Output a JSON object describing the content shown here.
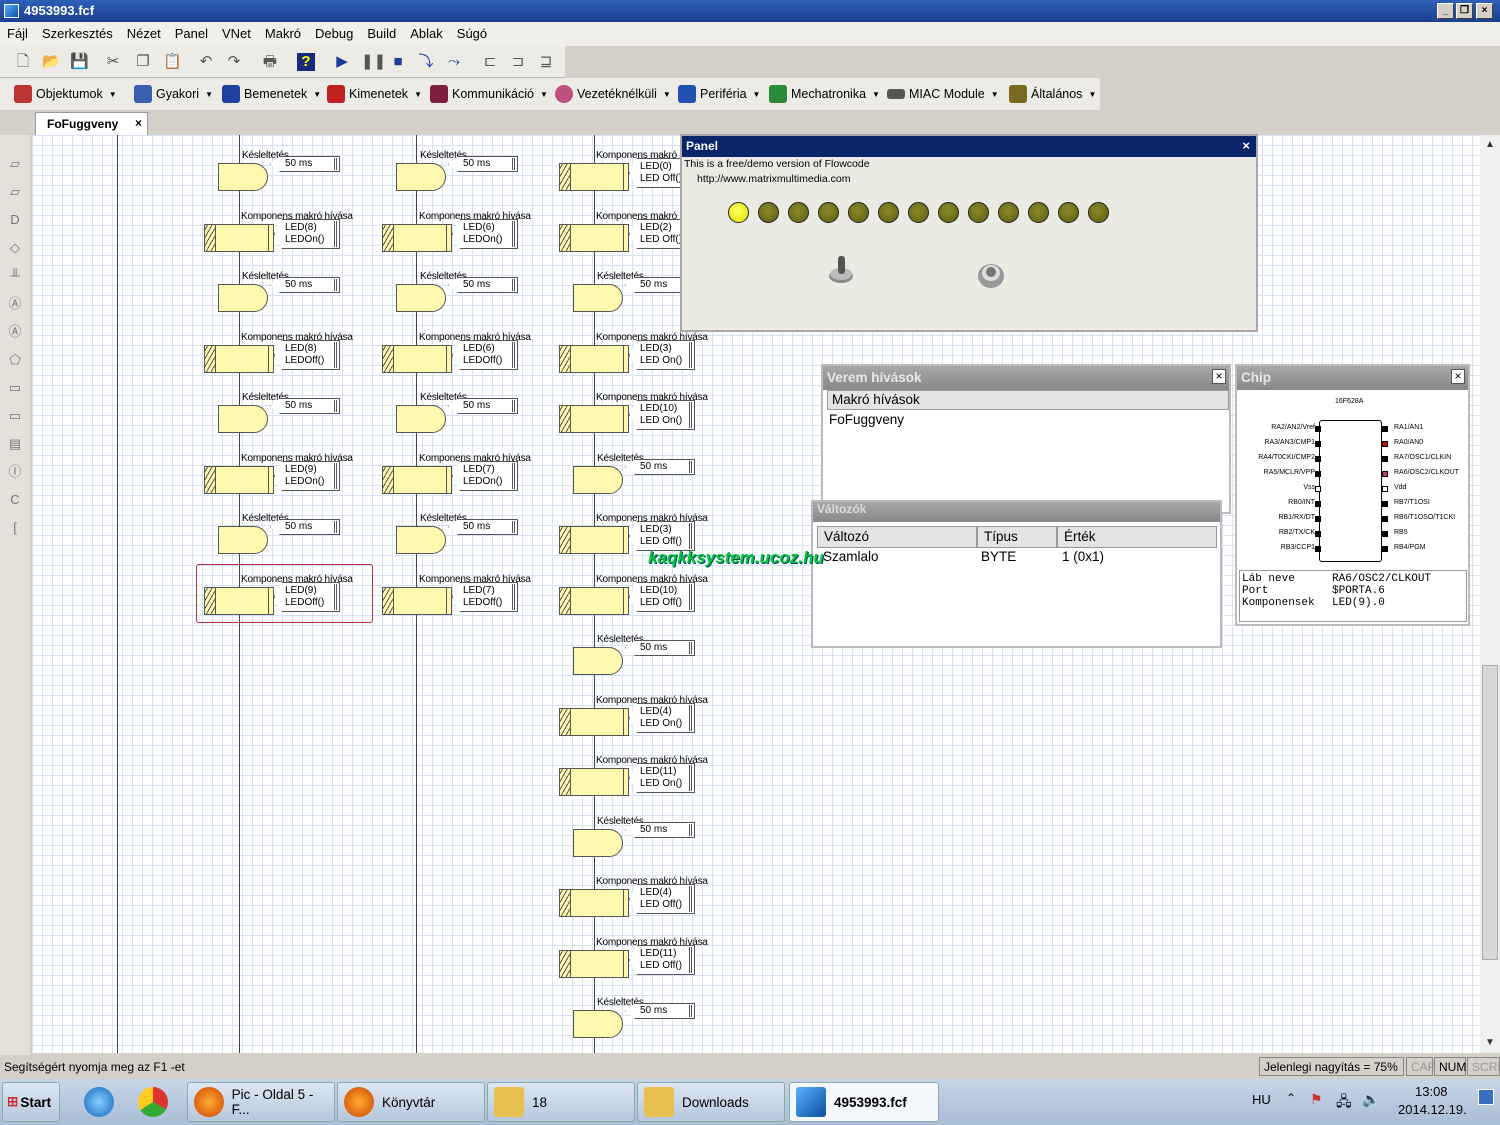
{
  "window": {
    "title": "4953993.fcf"
  },
  "menu": [
    "Fájl",
    "Szerkesztés",
    "Nézet",
    "Panel",
    "VNet",
    "Makró",
    "Debug",
    "Build",
    "Ablak",
    "Súgó"
  ],
  "toolbar2": [
    "Objektumok",
    "Gyakori",
    "Bemenetek",
    "Kimenetek",
    "Kommunikáció",
    "Vezetéknélküli",
    "Periféria",
    "Mechatronika",
    "MIAC Module",
    "Általános"
  ],
  "tab": {
    "label": "FoFuggveny",
    "close": "×"
  },
  "flow": {
    "delay_label": "Késleltetés",
    "macro_label": "Komponens makró hívása",
    "delay_value": "50 ms",
    "col1": [
      [
        "LED(8)",
        "LEDOn()"
      ],
      [
        "LED(8)",
        "LEDOff()"
      ],
      [
        "LED(9)",
        "LEDOn()"
      ],
      [
        "LED(9)",
        "LEDOff()"
      ]
    ],
    "col2": [
      [
        "LED(6)",
        "LEDOn()"
      ],
      [
        "LED(6)",
        "LEDOff()"
      ],
      [
        "LED(7)",
        "LEDOn()"
      ],
      [
        "LED(7)",
        "LEDOff()"
      ]
    ],
    "col3": [
      [
        "LED(0)",
        "LED Off()"
      ],
      [
        "LED(2)",
        "LED Off()"
      ],
      [
        "LED(3)",
        "LED On()"
      ],
      [
        "LED(10)",
        "LED On()"
      ],
      [
        "LED(3)",
        "LED Off()"
      ],
      [
        "LED(10)",
        "LED Off()"
      ],
      [
        "LED(4)",
        "LED On()"
      ],
      [
        "LED(11)",
        "LED On()"
      ],
      [
        "LED(4)",
        "LED Off()"
      ],
      [
        "LED(11)",
        "LED Off()"
      ]
    ]
  },
  "panel": {
    "title": "Panel",
    "close": "×",
    "line1": "This is a free/demo version of Flowcode",
    "line2": "http://www.matrixmultimedia.com",
    "leds_on": [
      true,
      false,
      false,
      false,
      false,
      false,
      false,
      false,
      false,
      false,
      false,
      false,
      false
    ]
  },
  "verem": {
    "title": "Verem hívások",
    "close": "×",
    "header": "Makró hívások",
    "item": "FoFuggveny"
  },
  "valtozok": {
    "title": "Változók",
    "cols": [
      "Változó",
      "Típus",
      "Érték"
    ],
    "row": [
      "Szamlalo",
      "BYTE",
      "1 (0x1)"
    ]
  },
  "watermark": "kaqkksystem.ucoz.hu",
  "chip": {
    "title": "Chip",
    "close": "×",
    "name": "16F628A",
    "left_pins": [
      "RA2/AN2/Vref",
      "RA3/AN3/CMP1",
      "RA4/T0CKI/CMP2",
      "RA5/MCLR/VPP",
      "Vss",
      "RB0/INT",
      "RB1/RX/DT",
      "RB2/TX/CK",
      "RB3/CCP1"
    ],
    "right_pins": [
      "RA1/AN1",
      "RA0/AN0",
      "RA7/OSC1/CLKIN",
      "RA6/OSC2/CLKOUT",
      "Vdd",
      "RB7/T1OSI",
      "RB6/T1OSO/T1CKI",
      "RB5",
      "RB4/PGM"
    ],
    "info": [
      [
        "Láb neve",
        "RA6/OSC2/CLKOUT"
      ],
      [
        "Port",
        "$PORTA.6"
      ],
      [
        "Komponensek",
        "LED(9).0"
      ]
    ]
  },
  "status": {
    "help": "Segítségért nyomja meg az F1 -et",
    "zoom": "Jelenlegi nagyítás = 75%",
    "cap": "CAP",
    "num": "NUM",
    "scrl": "SCRL"
  },
  "taskbar": {
    "start": "Start",
    "items": [
      "Pic - Oldal 5 - F...",
      "Könyvtár",
      "18",
      "Downloads",
      "4953993.fcf"
    ],
    "lang": "HU",
    "time": "13:08",
    "date": "2014.12.19."
  }
}
